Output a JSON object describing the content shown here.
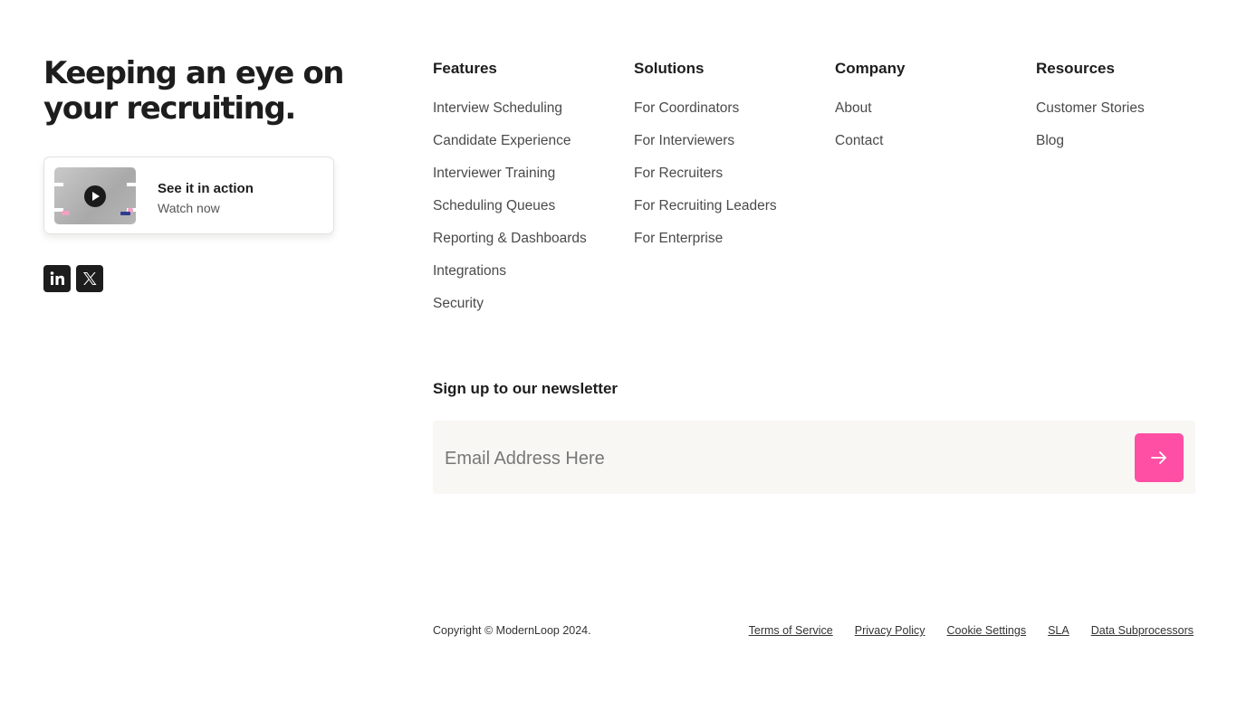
{
  "brand": {
    "headline": "Keeping an eye on your recruiting."
  },
  "video_card": {
    "title": "See it in action",
    "subtitle": "Watch now"
  },
  "social": {
    "linkedin_label": "in"
  },
  "columns": [
    {
      "heading": "Features",
      "links": [
        "Interview Scheduling",
        "Candidate Experience",
        "Interviewer Training",
        "Scheduling Queues",
        "Reporting & Dashboards",
        "Integrations",
        "Security"
      ]
    },
    {
      "heading": "Solutions",
      "links": [
        "For Coordinators",
        "For Interviewers",
        "For Recruiters",
        "For Recruiting Leaders",
        "For Enterprise"
      ]
    },
    {
      "heading": "Company",
      "links": [
        "About",
        "Contact"
      ]
    },
    {
      "heading": "Resources",
      "links": [
        "Customer Stories",
        "Blog"
      ]
    }
  ],
  "newsletter": {
    "title": "Sign up to our newsletter",
    "placeholder": "Email Address Here",
    "value": "",
    "submit_icon": "arrow-right-icon"
  },
  "footer": {
    "copyright": "Copyright © ModernLoop 2024.",
    "legal_links": [
      "Terms of Service",
      "Privacy Policy",
      "Cookie Settings",
      "SLA",
      "Data Subprocessors"
    ]
  },
  "colors": {
    "accent": "#ff4fa4",
    "text": "#1d1d1d",
    "input_bg": "#f8f7f4"
  }
}
